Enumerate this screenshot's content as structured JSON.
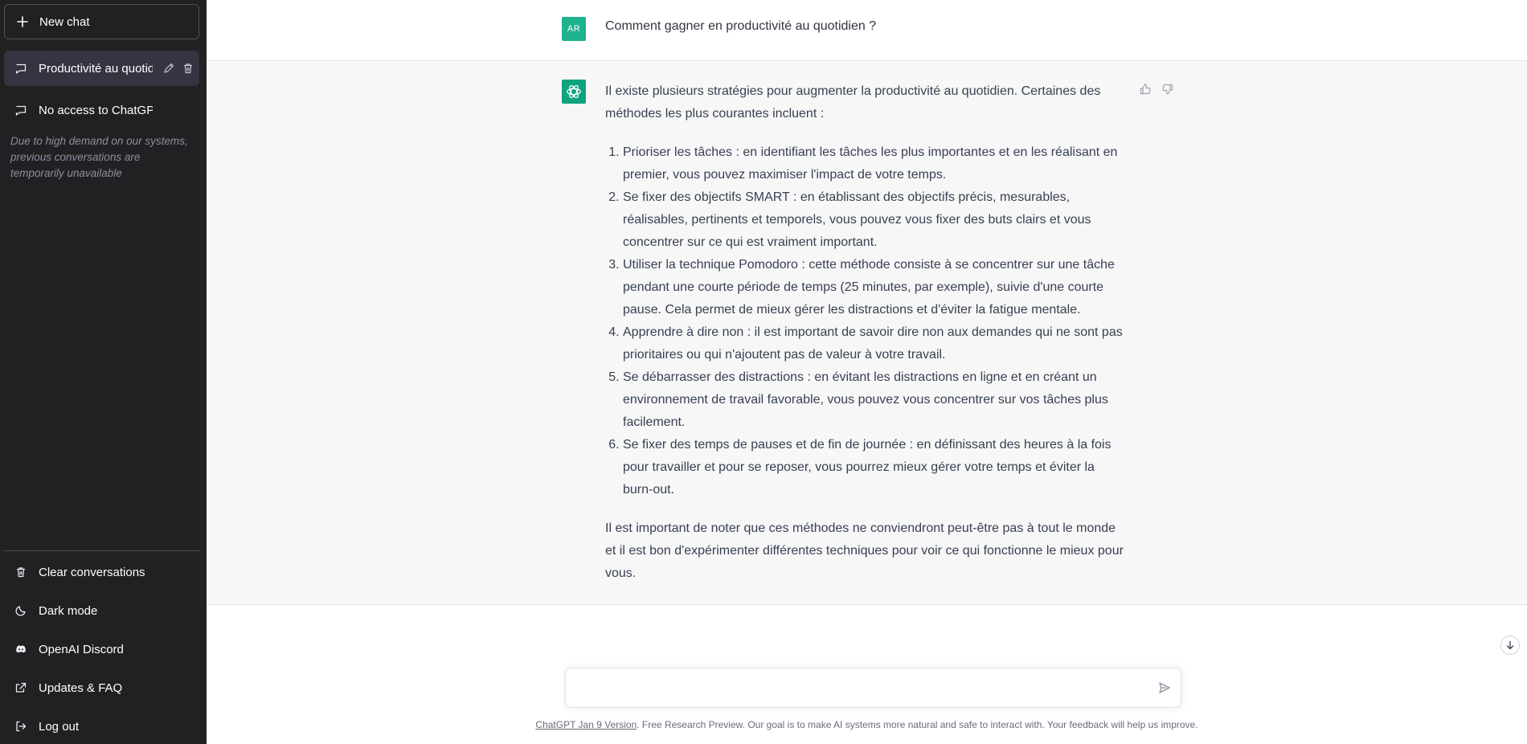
{
  "sidebar": {
    "new_chat_label": "New chat",
    "conversations": [
      {
        "label": "Productivité au quotidi",
        "active": true
      },
      {
        "label": "No access to ChatGPT",
        "active": false
      }
    ],
    "notice": "Due to high demand on our systems, previous conversations are temporarily unavailable",
    "menu": {
      "clear": "Clear conversations",
      "dark": "Dark mode",
      "discord": "OpenAI Discord",
      "faq": "Updates & FAQ",
      "logout": "Log out"
    }
  },
  "chat": {
    "user_initials": "AR",
    "user_message": "Comment gagner en productivité au quotidien ?",
    "ai_intro": "Il existe plusieurs stratégies pour augmenter la productivité au quotidien. Certaines des méthodes les plus courantes incluent :",
    "ai_list": [
      "Prioriser les tâches : en identifiant les tâches les plus importantes et en les réalisant en premier, vous pouvez maximiser l'impact de votre temps.",
      "Se fixer des objectifs SMART : en établissant des objectifs précis, mesurables, réalisables, pertinents et temporels, vous pouvez vous fixer des buts clairs et vous concentrer sur ce qui est vraiment important.",
      "Utiliser la technique Pomodoro : cette méthode consiste à se concentrer sur une tâche pendant une courte période de temps (25 minutes, par exemple), suivie d'une courte pause. Cela permet de mieux gérer les distractions et d'éviter la fatigue mentale.",
      "Apprendre à dire non : il est important de savoir dire non aux demandes qui ne sont pas prioritaires ou qui n'ajoutent pas de valeur à votre travail.",
      "Se débarrasser des distractions : en évitant les distractions en ligne et en créant un environnement de travail favorable, vous pouvez vous concentrer sur vos tâches plus facilement.",
      "Se fixer des temps de pauses et de fin de journée : en définissant des heures à la fois pour travailler et pour se reposer, vous pourrez mieux gérer votre temps et éviter la burn-out."
    ],
    "ai_outro": "Il est important de noter que ces méthodes ne conviendront peut-être pas à tout le monde et il est bon d'expérimenter différentes techniques pour voir ce qui fonctionne le mieux pour vous."
  },
  "composer": {
    "value": "",
    "footer_link": "ChatGPT Jan 9 Version",
    "footer_text": ". Free Research Preview. Our goal is to make AI systems more natural and safe to interact with. Your feedback will help us improve."
  },
  "colors": {
    "sidebar_bg": "#202123",
    "accent": "#10a37f",
    "user_avatar": "#1fb28e"
  }
}
